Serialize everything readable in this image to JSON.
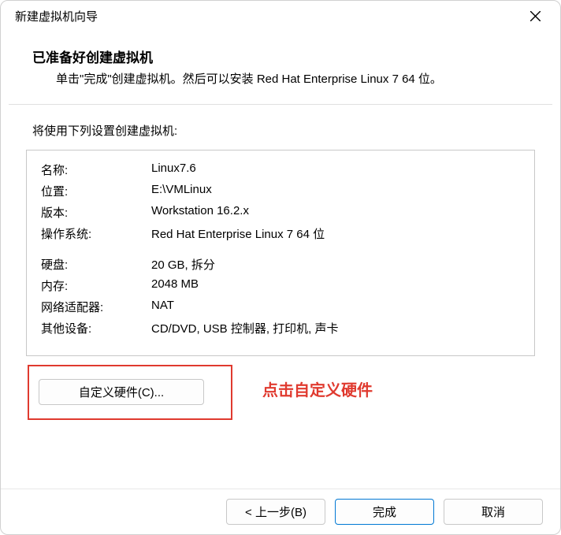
{
  "titlebar": {
    "title": "新建虚拟机向导"
  },
  "header": {
    "title": "已准备好创建虚拟机",
    "desc": "单击\"完成\"创建虚拟机。然后可以安装 Red Hat Enterprise Linux 7 64 位。"
  },
  "prompt": "将使用下列设置创建虚拟机:",
  "spec": {
    "rows": [
      {
        "k": "名称:",
        "v": "Linux7.6"
      },
      {
        "k": "位置:",
        "v": "E:\\VMLinux"
      },
      {
        "k": "版本:",
        "v": "Workstation 16.2.x"
      },
      {
        "k": "操作系统:",
        "v": "Red Hat Enterprise Linux 7 64 位"
      }
    ],
    "rows2": [
      {
        "k": "硬盘:",
        "v": "20 GB, 拆分"
      },
      {
        "k": "内存:",
        "v": "2048 MB"
      },
      {
        "k": "网络适配器:",
        "v": "NAT"
      },
      {
        "k": "其他设备:",
        "v": "CD/DVD, USB 控制器, 打印机, 声卡"
      }
    ]
  },
  "customizeBtn": "自定义硬件(C)...",
  "hint": "点击自定义硬件",
  "footer": {
    "back": "< 上一步(B)",
    "finish": "完成",
    "cancel": "取消"
  },
  "annotationColor": "#e03a2f",
  "accent": "#0078d4"
}
